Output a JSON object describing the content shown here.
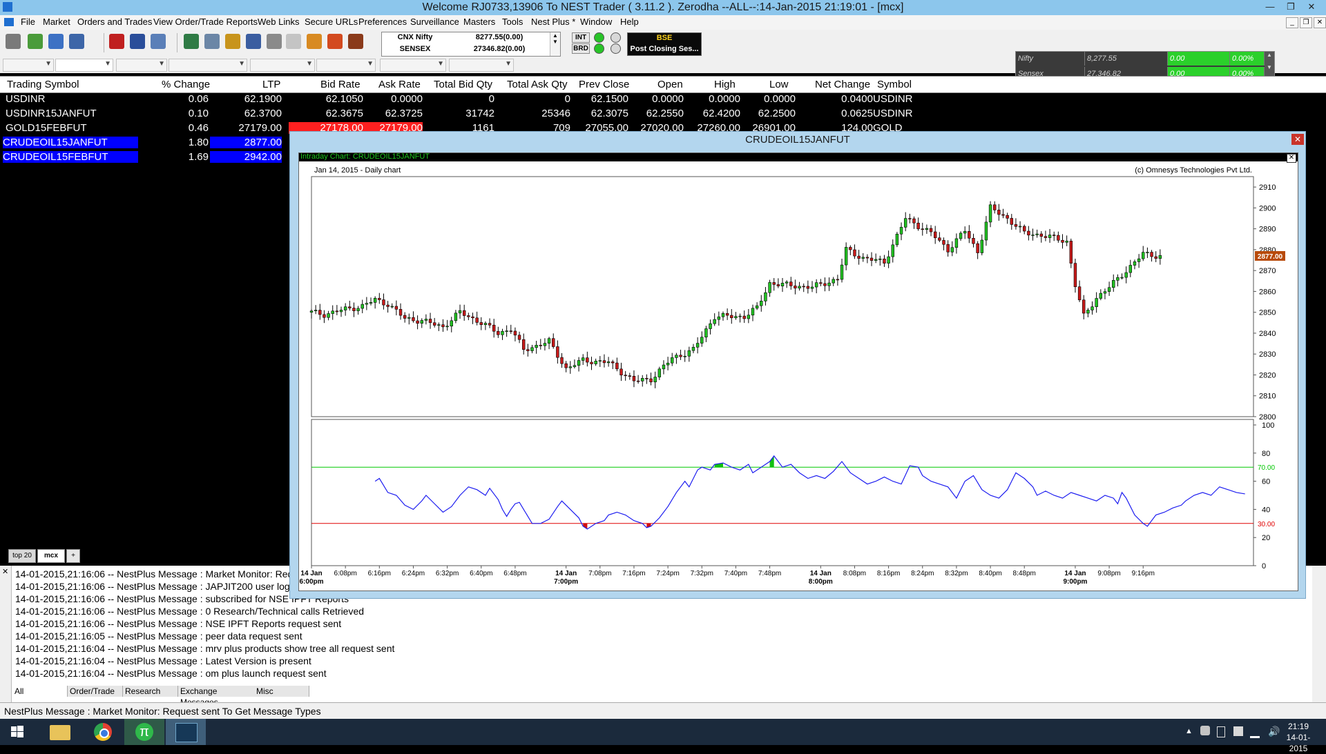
{
  "window": {
    "title": "Welcome RJ0733,13906 To NEST Trader ( 3.11.2 ).  Zerodha --ALL--:14-Jan-2015 21:19:01 - [mcx]"
  },
  "menu": [
    "File",
    "Market",
    "Orders and Trades",
    "View Order/Trade Reports",
    "Web Links",
    "Secure URLs",
    "Preferences",
    "Surveillance",
    "Masters",
    "Tools",
    "Nest Plus *",
    "Window",
    "Help"
  ],
  "indices": [
    {
      "name": "CNX Nifty",
      "value": "8277.55(0.00)"
    },
    {
      "name": "SENSEX",
      "value": "27346.82(0.00)"
    }
  ],
  "status_chips": {
    "int": "INT",
    "brd": "BRD"
  },
  "bse": {
    "line1": "BSE",
    "line2": "Post Closing Ses..."
  },
  "mini_ticker": [
    {
      "name": "Nifty",
      "value": "8,277.55",
      "change": "0.00",
      "pct": "0.00%"
    },
    {
      "name": "Sensex",
      "value": "27,346.82",
      "change": "0.00",
      "pct": "0.00%"
    }
  ],
  "market_watch": {
    "columns": [
      "Trading Symbol",
      "% Change",
      "LTP",
      "Bid Rate",
      "Ask Rate",
      "Total Bid Qty",
      "Total Ask Qty",
      "Prev Close",
      "Open",
      "High",
      "Low",
      "Net Change",
      "Symbol"
    ],
    "rows": [
      {
        "symbol": "USDINR",
        "pct": "0.06",
        "ltp": "62.1900",
        "bid": "62.1050",
        "ask": "0.0000",
        "tbq": "0",
        "taq": "0",
        "prev": "62.1500",
        "open": "0.0000",
        "high": "0.0000",
        "low": "0.0000",
        "net": "0.0400",
        "sym": "USDINR"
      },
      {
        "symbol": "USDINR15JANFUT",
        "pct": "0.10",
        "ltp": "62.3700",
        "bid": "62.3675",
        "ask": "62.3725",
        "tbq": "31742",
        "taq": "25346",
        "prev": "62.3075",
        "open": "62.2550",
        "high": "62.4200",
        "low": "62.2500",
        "net": "0.0625",
        "sym": "USDINR"
      },
      {
        "symbol": "GOLD15FEBFUT",
        "pct": "0.46",
        "ltp": "27179.00",
        "bid": "27178.00",
        "ask": "27179.00",
        "tbq": "1161",
        "taq": "709",
        "prev": "27055.00",
        "open": "27020.00",
        "high": "27260.00",
        "low": "26901.00",
        "net": "124.00",
        "sym": "GOLD"
      },
      {
        "symbol": "CRUDEOIL15JANFUT",
        "pct": "1.80",
        "ltp": "2877.00"
      },
      {
        "symbol": "CRUDEOIL15FEBFUT",
        "pct": "1.69",
        "ltp": "2942.00"
      }
    ]
  },
  "watch_tabs": [
    "top 20",
    "mcx",
    "+"
  ],
  "chart_window": {
    "title": "CRUDEOIL15JANFUT",
    "strip": "Intraday Chart: CRUDEOIL15JANFUT",
    "subtitle": "Jan 14, 2015 - Daily chart",
    "copyright": "(c) Omnesys Technologies Pvt Ltd.",
    "last_price_label": "2877.00"
  },
  "chart_data": {
    "type": "candlestick",
    "price_axis": {
      "min": 2800,
      "max": 2915,
      "ticks": [
        2800,
        2810,
        2820,
        2830,
        2840,
        2850,
        2860,
        2870,
        2880,
        2890,
        2900,
        2910
      ]
    },
    "indicator_axis": {
      "min": 0,
      "max": 100,
      "ticks": [
        0,
        20,
        40,
        60,
        80,
        100
      ]
    },
    "levels": [
      {
        "value": 70,
        "label": "70.00",
        "color": "#00c800"
      },
      {
        "value": 30,
        "label": "30.00",
        "color": "#e00000"
      }
    ],
    "x_labels": [
      {
        "t": 0,
        "main": "14 Jan",
        "sub": "6:00pm"
      },
      {
        "t": 8,
        "main": "6:08pm"
      },
      {
        "t": 16,
        "main": "6:16pm"
      },
      {
        "t": 24,
        "main": "6:24pm"
      },
      {
        "t": 32,
        "main": "6:32pm"
      },
      {
        "t": 40,
        "main": "6:40pm"
      },
      {
        "t": 48,
        "main": "6:48pm"
      },
      {
        "t": 60,
        "main": "14 Jan",
        "sub": "7:00pm"
      },
      {
        "t": 68,
        "main": "7:08pm"
      },
      {
        "t": 76,
        "main": "7:16pm"
      },
      {
        "t": 84,
        "main": "7:24pm"
      },
      {
        "t": 92,
        "main": "7:32pm"
      },
      {
        "t": 100,
        "main": "7:40pm"
      },
      {
        "t": 108,
        "main": "7:48pm"
      },
      {
        "t": 120,
        "main": "14 Jan",
        "sub": "8:00pm"
      },
      {
        "t": 128,
        "main": "8:08pm"
      },
      {
        "t": 136,
        "main": "8:16pm"
      },
      {
        "t": 144,
        "main": "8:24pm"
      },
      {
        "t": 152,
        "main": "8:32pm"
      },
      {
        "t": 160,
        "main": "8:40pm"
      },
      {
        "t": 168,
        "main": "8:48pm"
      },
      {
        "t": 180,
        "main": "14 Jan",
        "sub": "9:00pm"
      },
      {
        "t": 188,
        "main": "9:08pm"
      },
      {
        "t": 196,
        "main": "9:16pm"
      }
    ],
    "price_path": [
      [
        0,
        2850
      ],
      [
        3,
        2849
      ],
      [
        7,
        2851
      ],
      [
        12,
        2853
      ],
      [
        15,
        2856
      ],
      [
        18,
        2854
      ],
      [
        22,
        2847
      ],
      [
        26,
        2846
      ],
      [
        31,
        2843
      ],
      [
        35,
        2850
      ],
      [
        40,
        2845
      ],
      [
        44,
        2840
      ],
      [
        47,
        2842
      ],
      [
        50,
        2832
      ],
      [
        56,
        2836
      ],
      [
        60,
        2823
      ],
      [
        64,
        2827
      ],
      [
        70,
        2826
      ],
      [
        76,
        2817
      ],
      [
        80,
        2818
      ],
      [
        85,
        2828
      ],
      [
        90,
        2832
      ],
      [
        95,
        2848
      ],
      [
        102,
        2848
      ],
      [
        105,
        2852
      ],
      [
        108,
        2864
      ],
      [
        112,
        2863
      ],
      [
        118,
        2862
      ],
      [
        124,
        2866
      ],
      [
        126,
        2880
      ],
      [
        130,
        2876
      ],
      [
        135,
        2874
      ],
      [
        140,
        2895
      ],
      [
        146,
        2888
      ],
      [
        150,
        2880
      ],
      [
        154,
        2889
      ],
      [
        157,
        2879
      ],
      [
        160,
        2900
      ],
      [
        164,
        2895
      ],
      [
        168,
        2888
      ],
      [
        172,
        2887
      ],
      [
        178,
        2884
      ],
      [
        180,
        2863
      ],
      [
        182,
        2848
      ],
      [
        185,
        2857
      ],
      [
        188,
        2862
      ],
      [
        192,
        2870
      ],
      [
        196,
        2878
      ],
      [
        200,
        2877
      ]
    ],
    "indicator_path": [
      [
        15,
        60
      ],
      [
        16,
        62
      ],
      [
        17,
        57
      ],
      [
        18,
        52
      ],
      [
        20,
        50
      ],
      [
        22,
        43
      ],
      [
        24,
        40
      ],
      [
        26,
        46
      ],
      [
        27,
        50
      ],
      [
        29,
        44
      ],
      [
        31,
        38
      ],
      [
        33,
        42
      ],
      [
        35,
        50
      ],
      [
        37,
        56
      ],
      [
        39,
        54
      ],
      [
        41,
        50
      ],
      [
        42,
        55
      ],
      [
        44,
        47
      ],
      [
        45,
        40
      ],
      [
        46,
        35
      ],
      [
        47,
        40
      ],
      [
        48,
        44
      ],
      [
        49,
        45
      ],
      [
        50,
        40
      ],
      [
        51,
        35
      ],
      [
        52,
        30
      ],
      [
        54,
        30
      ],
      [
        56,
        33
      ],
      [
        58,
        42
      ],
      [
        59,
        46
      ],
      [
        61,
        40
      ],
      [
        63,
        34
      ],
      [
        64,
        28
      ],
      [
        65,
        26
      ],
      [
        67,
        30
      ],
      [
        69,
        32
      ],
      [
        70,
        36
      ],
      [
        72,
        38
      ],
      [
        74,
        36
      ],
      [
        76,
        32
      ],
      [
        78,
        30
      ],
      [
        79,
        27
      ],
      [
        80,
        28
      ],
      [
        82,
        34
      ],
      [
        84,
        42
      ],
      [
        86,
        52
      ],
      [
        88,
        60
      ],
      [
        89,
        56
      ],
      [
        90,
        62
      ],
      [
        91,
        68
      ],
      [
        92,
        70
      ],
      [
        94,
        68
      ],
      [
        95,
        72
      ],
      [
        97,
        73
      ],
      [
        99,
        70
      ],
      [
        101,
        68
      ],
      [
        103,
        72
      ],
      [
        104,
        66
      ],
      [
        106,
        70
      ],
      [
        108,
        74
      ],
      [
        109,
        78
      ],
      [
        111,
        70
      ],
      [
        113,
        72
      ],
      [
        115,
        66
      ],
      [
        117,
        62
      ],
      [
        119,
        64
      ],
      [
        121,
        62
      ],
      [
        123,
        67
      ],
      [
        125,
        74
      ],
      [
        127,
        66
      ],
      [
        129,
        62
      ],
      [
        131,
        58
      ],
      [
        133,
        60
      ],
      [
        135,
        63
      ],
      [
        137,
        60
      ],
      [
        139,
        58
      ],
      [
        141,
        71
      ],
      [
        143,
        70
      ],
      [
        144,
        64
      ],
      [
        146,
        60
      ],
      [
        148,
        58
      ],
      [
        150,
        56
      ],
      [
        152,
        48
      ],
      [
        154,
        60
      ],
      [
        156,
        64
      ],
      [
        158,
        54
      ],
      [
        160,
        50
      ],
      [
        162,
        48
      ],
      [
        164,
        54
      ],
      [
        166,
        66
      ],
      [
        168,
        62
      ],
      [
        170,
        56
      ],
      [
        171,
        50
      ],
      [
        173,
        53
      ],
      [
        175,
        50
      ],
      [
        177,
        48
      ],
      [
        179,
        52
      ],
      [
        181,
        50
      ],
      [
        183,
        48
      ],
      [
        185,
        46
      ],
      [
        187,
        50
      ],
      [
        189,
        48
      ],
      [
        190,
        44
      ],
      [
        191,
        52
      ],
      [
        192,
        48
      ],
      [
        194,
        36
      ],
      [
        196,
        30
      ],
      [
        197,
        28
      ],
      [
        199,
        36
      ],
      [
        201,
        38
      ],
      [
        203,
        41
      ],
      [
        205,
        43
      ],
      [
        206,
        46
      ],
      [
        208,
        50
      ],
      [
        210,
        52
      ],
      [
        212,
        50
      ],
      [
        214,
        56
      ],
      [
        216,
        54
      ],
      [
        218,
        52
      ],
      [
        220,
        51
      ]
    ]
  }
}
